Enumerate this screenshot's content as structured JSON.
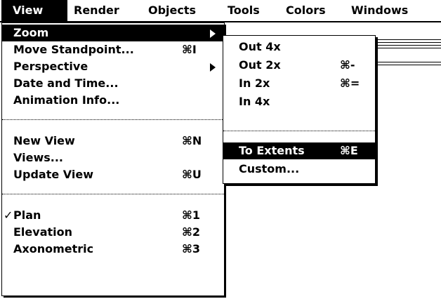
{
  "menubar": {
    "titles": [
      "View",
      "Render",
      "Objects",
      "Tools",
      "Colors",
      "Windows"
    ]
  },
  "view_menu": {
    "items": [
      {
        "label": "Zoom",
        "key": ""
      },
      {
        "label": "Move Standpoint...",
        "key": "⌘I"
      },
      {
        "label": "Perspective",
        "key": ""
      },
      {
        "label": "Date and Time...",
        "key": ""
      },
      {
        "label": "Animation Info...",
        "key": ""
      },
      {
        "label": "New View",
        "key": "⌘N"
      },
      {
        "label": "Views...",
        "key": ""
      },
      {
        "label": "Update View",
        "key": "⌘U"
      },
      {
        "label": "Plan",
        "key": "⌘1",
        "check": "✓"
      },
      {
        "label": "Elevation",
        "key": "⌘2"
      },
      {
        "label": "Axonometric",
        "key": "⌘3"
      }
    ]
  },
  "zoom_menu": {
    "items": [
      {
        "label": "Out 4x",
        "key": ""
      },
      {
        "label": "Out 2x",
        "key": "⌘-"
      },
      {
        "label": "In 2x",
        "key": "⌘="
      },
      {
        "label": "In 4x",
        "key": ""
      },
      {
        "label": "To Extents",
        "key": "⌘E"
      },
      {
        "label": "Custom...",
        "key": ""
      }
    ]
  }
}
